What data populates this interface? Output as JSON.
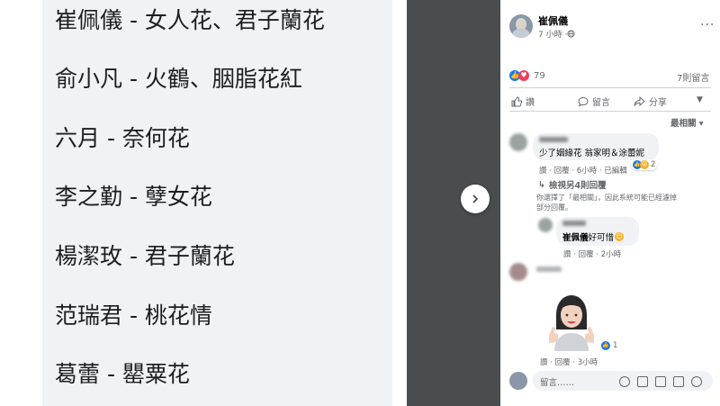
{
  "left_list": [
    "崔佩儀 - 女人花、君子蘭花",
    "俞小凡 - 火鶴、胭脂花紅",
    "六月 - 奈何花",
    "李之勤 - 孽女花",
    "楊潔玫 - 君子蘭花",
    "范瑞君 - 桃花情",
    "葛蕾 - 罌粟花"
  ],
  "post": {
    "author": "崔佩儀",
    "time": "7 小時 · ",
    "reaction_count": "79",
    "comments_count": "7則留言",
    "actions": {
      "like": "讚",
      "comment": "留言",
      "share": "分享"
    },
    "sort_label": "最相關 ▾",
    "comments": [
      {
        "text": "少了姻緣花 翁家明＆涂蕾妮",
        "meta": "讚 · 回覆 · 6小時 · 已編輯",
        "reaction_count": "2",
        "view_more": "檢視另4則回覆",
        "filter_notice": "你選擇了「最相關」，因此系統可能已經濾掉部分回覆。"
      },
      {
        "author": "崔佩儀",
        "text": " 好可惜",
        "meta": "讚 · 回覆 · 2小時"
      },
      {
        "meta": "讚 · 回覆 · 3小時",
        "reaction_count": "1"
      }
    ],
    "composer_placeholder": "留言……"
  },
  "colors": {
    "like_blue": "#1877f2",
    "love_red": "#f33e58",
    "dark_strip": "#4b4c4f",
    "panel_bg": "#f0f2f5"
  }
}
